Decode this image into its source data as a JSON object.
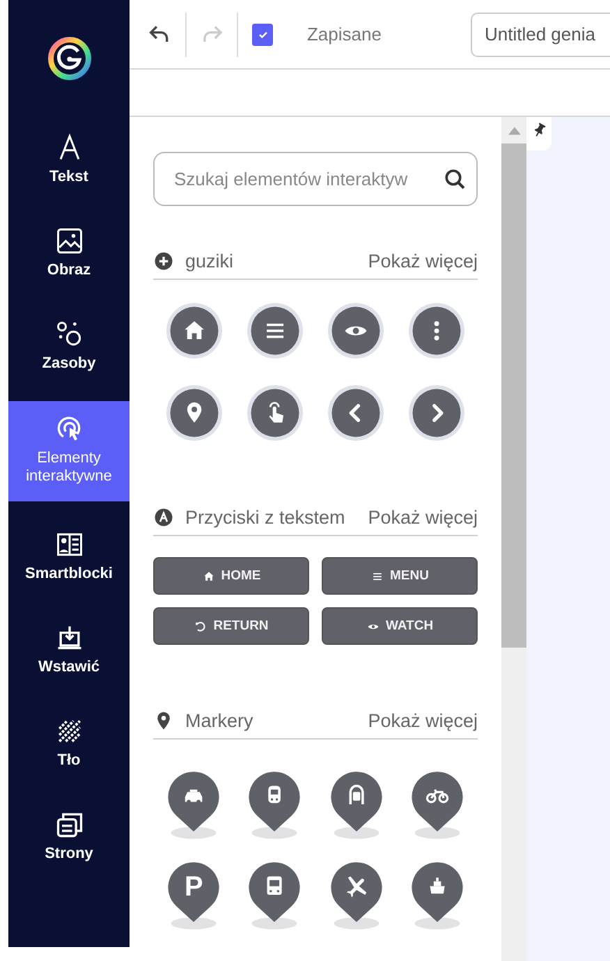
{
  "sidebar": {
    "items": [
      {
        "kind": "text",
        "label": "Tekst",
        "selected": false
      },
      {
        "kind": "image",
        "label": "Obraz",
        "selected": false
      },
      {
        "kind": "resources",
        "label": "Zasoby",
        "selected": false
      },
      {
        "kind": "interactive",
        "label": "Elementy interaktywne",
        "selected": true
      },
      {
        "kind": "smartblocks",
        "label": "Smartblocki",
        "selected": false
      },
      {
        "kind": "insert",
        "label": "Wstawić",
        "selected": false
      },
      {
        "kind": "background",
        "label": "Tło",
        "selected": false
      },
      {
        "kind": "pages",
        "label": "Strony",
        "selected": false
      }
    ]
  },
  "toolbar": {
    "buttons": [
      {
        "kind": "undo",
        "disabled": false
      },
      {
        "kind": "redo",
        "disabled": true
      }
    ],
    "save_status": {
      "label": "Zapisane",
      "checked": true
    },
    "title_field": {
      "value": "Untitled genia"
    }
  },
  "panel": {
    "search": {
      "placeholder": "Szukaj elementów interaktyw"
    },
    "sections": [
      {
        "kind": "icon_buttons",
        "title": "guziki",
        "more": "Pokaż więcej",
        "items": [
          {
            "kind": "home"
          },
          {
            "kind": "menu"
          },
          {
            "kind": "eye"
          },
          {
            "kind": "dots"
          },
          {
            "kind": "pin"
          },
          {
            "kind": "hand"
          },
          {
            "kind": "left"
          },
          {
            "kind": "right"
          }
        ]
      },
      {
        "kind": "text_buttons",
        "title": "Przyciski z tekstem",
        "more": "Pokaż więcej",
        "items": [
          {
            "kind": "home",
            "label": "HOME"
          },
          {
            "kind": "menu",
            "label": "MENU"
          },
          {
            "kind": "return",
            "label": "RETURN"
          },
          {
            "kind": "eye",
            "label": "WATCH"
          }
        ]
      },
      {
        "kind": "markers",
        "title": "Markery",
        "more": "Pokaż więcej",
        "items": [
          {
            "kind": "car"
          },
          {
            "kind": "train"
          },
          {
            "kind": "metro"
          },
          {
            "kind": "bike"
          },
          {
            "kind": "parking",
            "glyph": "P"
          },
          {
            "kind": "bus"
          },
          {
            "kind": "plane"
          },
          {
            "kind": "ship"
          }
        ]
      }
    ]
  }
}
